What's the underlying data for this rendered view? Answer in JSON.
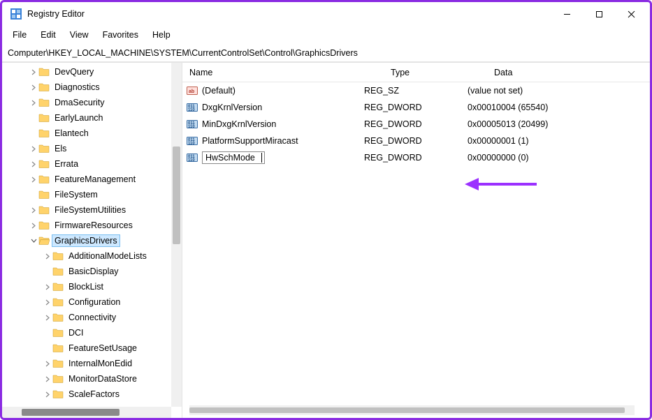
{
  "window": {
    "title": "Registry Editor"
  },
  "menu": {
    "file": "File",
    "edit": "Edit",
    "view": "View",
    "favorites": "Favorites",
    "help": "Help"
  },
  "address": "Computer\\HKEY_LOCAL_MACHINE\\SYSTEM\\CurrentControlSet\\Control\\GraphicsDrivers",
  "columns": {
    "name": "Name",
    "type": "Type",
    "data": "Data"
  },
  "tree": [
    {
      "label": "DevQuery",
      "expandable": true,
      "depth": 0
    },
    {
      "label": "Diagnostics",
      "expandable": true,
      "depth": 0
    },
    {
      "label": "DmaSecurity",
      "expandable": true,
      "depth": 0
    },
    {
      "label": "EarlyLaunch",
      "expandable": false,
      "depth": 0
    },
    {
      "label": "Elantech",
      "expandable": false,
      "depth": 0
    },
    {
      "label": "Els",
      "expandable": true,
      "depth": 0
    },
    {
      "label": "Errata",
      "expandable": true,
      "depth": 0
    },
    {
      "label": "FeatureManagement",
      "expandable": true,
      "depth": 0
    },
    {
      "label": "FileSystem",
      "expandable": false,
      "depth": 0
    },
    {
      "label": "FileSystemUtilities",
      "expandable": true,
      "depth": 0
    },
    {
      "label": "FirmwareResources",
      "expandable": true,
      "depth": 0
    },
    {
      "label": "GraphicsDrivers",
      "expandable": true,
      "expanded": true,
      "selected": true,
      "depth": 0
    },
    {
      "label": "AdditionalModeLists",
      "expandable": true,
      "depth": 1
    },
    {
      "label": "BasicDisplay",
      "expandable": false,
      "depth": 1
    },
    {
      "label": "BlockList",
      "expandable": true,
      "depth": 1
    },
    {
      "label": "Configuration",
      "expandable": true,
      "depth": 1
    },
    {
      "label": "Connectivity",
      "expandable": true,
      "depth": 1
    },
    {
      "label": "DCI",
      "expandable": false,
      "depth": 1
    },
    {
      "label": "FeatureSetUsage",
      "expandable": false,
      "depth": 1
    },
    {
      "label": "InternalMonEdid",
      "expandable": true,
      "depth": 1
    },
    {
      "label": "MonitorDataStore",
      "expandable": true,
      "depth": 1
    },
    {
      "label": "ScaleFactors",
      "expandable": true,
      "depth": 1
    }
  ],
  "values": [
    {
      "name": "(Default)",
      "type": "REG_SZ",
      "data": "(value not set)",
      "icon": "string"
    },
    {
      "name": "DxgKrnlVersion",
      "type": "REG_DWORD",
      "data": "0x00010004 (65540)",
      "icon": "dword"
    },
    {
      "name": "MinDxgKrnlVersion",
      "type": "REG_DWORD",
      "data": "0x00005013 (20499)",
      "icon": "dword"
    },
    {
      "name": "PlatformSupportMiracast",
      "type": "REG_DWORD",
      "data": "0x00000001 (1)",
      "icon": "dword"
    },
    {
      "name": "HwSchMode",
      "type": "REG_DWORD",
      "data": "0x00000000 (0)",
      "icon": "dword",
      "editing": true
    }
  ]
}
